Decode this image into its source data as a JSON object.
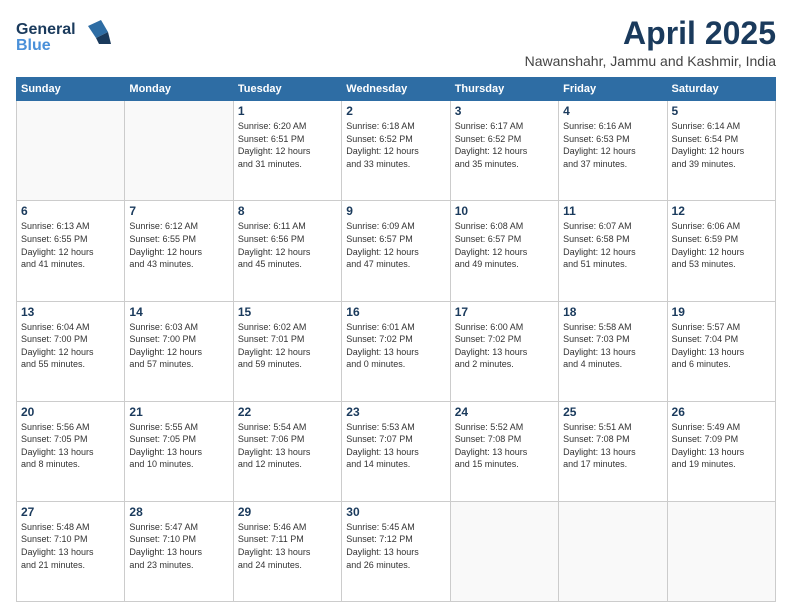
{
  "header": {
    "logo_line1": "General",
    "logo_line2": "Blue",
    "month": "April 2025",
    "location": "Nawanshahr, Jammu and Kashmir, India"
  },
  "weekdays": [
    "Sunday",
    "Monday",
    "Tuesday",
    "Wednesday",
    "Thursday",
    "Friday",
    "Saturday"
  ],
  "rows": [
    [
      {
        "day": "",
        "info": ""
      },
      {
        "day": "",
        "info": ""
      },
      {
        "day": "1",
        "info": "Sunrise: 6:20 AM\nSunset: 6:51 PM\nDaylight: 12 hours\nand 31 minutes."
      },
      {
        "day": "2",
        "info": "Sunrise: 6:18 AM\nSunset: 6:52 PM\nDaylight: 12 hours\nand 33 minutes."
      },
      {
        "day": "3",
        "info": "Sunrise: 6:17 AM\nSunset: 6:52 PM\nDaylight: 12 hours\nand 35 minutes."
      },
      {
        "day": "4",
        "info": "Sunrise: 6:16 AM\nSunset: 6:53 PM\nDaylight: 12 hours\nand 37 minutes."
      },
      {
        "day": "5",
        "info": "Sunrise: 6:14 AM\nSunset: 6:54 PM\nDaylight: 12 hours\nand 39 minutes."
      }
    ],
    [
      {
        "day": "6",
        "info": "Sunrise: 6:13 AM\nSunset: 6:55 PM\nDaylight: 12 hours\nand 41 minutes."
      },
      {
        "day": "7",
        "info": "Sunrise: 6:12 AM\nSunset: 6:55 PM\nDaylight: 12 hours\nand 43 minutes."
      },
      {
        "day": "8",
        "info": "Sunrise: 6:11 AM\nSunset: 6:56 PM\nDaylight: 12 hours\nand 45 minutes."
      },
      {
        "day": "9",
        "info": "Sunrise: 6:09 AM\nSunset: 6:57 PM\nDaylight: 12 hours\nand 47 minutes."
      },
      {
        "day": "10",
        "info": "Sunrise: 6:08 AM\nSunset: 6:57 PM\nDaylight: 12 hours\nand 49 minutes."
      },
      {
        "day": "11",
        "info": "Sunrise: 6:07 AM\nSunset: 6:58 PM\nDaylight: 12 hours\nand 51 minutes."
      },
      {
        "day": "12",
        "info": "Sunrise: 6:06 AM\nSunset: 6:59 PM\nDaylight: 12 hours\nand 53 minutes."
      }
    ],
    [
      {
        "day": "13",
        "info": "Sunrise: 6:04 AM\nSunset: 7:00 PM\nDaylight: 12 hours\nand 55 minutes."
      },
      {
        "day": "14",
        "info": "Sunrise: 6:03 AM\nSunset: 7:00 PM\nDaylight: 12 hours\nand 57 minutes."
      },
      {
        "day": "15",
        "info": "Sunrise: 6:02 AM\nSunset: 7:01 PM\nDaylight: 12 hours\nand 59 minutes."
      },
      {
        "day": "16",
        "info": "Sunrise: 6:01 AM\nSunset: 7:02 PM\nDaylight: 13 hours\nand 0 minutes."
      },
      {
        "day": "17",
        "info": "Sunrise: 6:00 AM\nSunset: 7:02 PM\nDaylight: 13 hours\nand 2 minutes."
      },
      {
        "day": "18",
        "info": "Sunrise: 5:58 AM\nSunset: 7:03 PM\nDaylight: 13 hours\nand 4 minutes."
      },
      {
        "day": "19",
        "info": "Sunrise: 5:57 AM\nSunset: 7:04 PM\nDaylight: 13 hours\nand 6 minutes."
      }
    ],
    [
      {
        "day": "20",
        "info": "Sunrise: 5:56 AM\nSunset: 7:05 PM\nDaylight: 13 hours\nand 8 minutes."
      },
      {
        "day": "21",
        "info": "Sunrise: 5:55 AM\nSunset: 7:05 PM\nDaylight: 13 hours\nand 10 minutes."
      },
      {
        "day": "22",
        "info": "Sunrise: 5:54 AM\nSunset: 7:06 PM\nDaylight: 13 hours\nand 12 minutes."
      },
      {
        "day": "23",
        "info": "Sunrise: 5:53 AM\nSunset: 7:07 PM\nDaylight: 13 hours\nand 14 minutes."
      },
      {
        "day": "24",
        "info": "Sunrise: 5:52 AM\nSunset: 7:08 PM\nDaylight: 13 hours\nand 15 minutes."
      },
      {
        "day": "25",
        "info": "Sunrise: 5:51 AM\nSunset: 7:08 PM\nDaylight: 13 hours\nand 17 minutes."
      },
      {
        "day": "26",
        "info": "Sunrise: 5:49 AM\nSunset: 7:09 PM\nDaylight: 13 hours\nand 19 minutes."
      }
    ],
    [
      {
        "day": "27",
        "info": "Sunrise: 5:48 AM\nSunset: 7:10 PM\nDaylight: 13 hours\nand 21 minutes."
      },
      {
        "day": "28",
        "info": "Sunrise: 5:47 AM\nSunset: 7:10 PM\nDaylight: 13 hours\nand 23 minutes."
      },
      {
        "day": "29",
        "info": "Sunrise: 5:46 AM\nSunset: 7:11 PM\nDaylight: 13 hours\nand 24 minutes."
      },
      {
        "day": "30",
        "info": "Sunrise: 5:45 AM\nSunset: 7:12 PM\nDaylight: 13 hours\nand 26 minutes."
      },
      {
        "day": "",
        "info": ""
      },
      {
        "day": "",
        "info": ""
      },
      {
        "day": "",
        "info": ""
      }
    ]
  ]
}
